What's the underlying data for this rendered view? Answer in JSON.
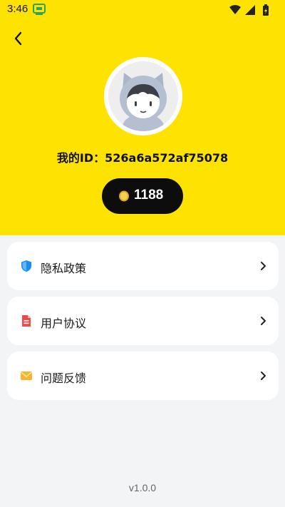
{
  "status_bar": {
    "time": "3:46",
    "app_notification_icon": "tv-app-icon",
    "wifi_icon": "wifi-icon",
    "signal_icon": "signal-icon",
    "battery_icon": "battery-charging-icon"
  },
  "header": {
    "back_icon": "chevron-left-icon",
    "avatar_icon": "cat-hood-avatar",
    "my_id_text": "我的ID：526a6a572af75078",
    "coin_icon": "gold-coin-icon",
    "coin_count": "1188"
  },
  "menu": {
    "items": [
      {
        "label": "隐私政策",
        "icon": "shield-icon",
        "icon_color": "#1b8bf5"
      },
      {
        "label": "用户协议",
        "icon": "document-icon",
        "icon_color": "#ef4a4a"
      },
      {
        "label": "问题反馈",
        "icon": "envelope-icon",
        "icon_color": "#f7b52c"
      }
    ]
  },
  "footer": {
    "version": "v1.0.0"
  },
  "colors": {
    "header_background": "#fde202",
    "page_background": "#f3f4f6",
    "coins_pill": "#0d0d0d"
  }
}
